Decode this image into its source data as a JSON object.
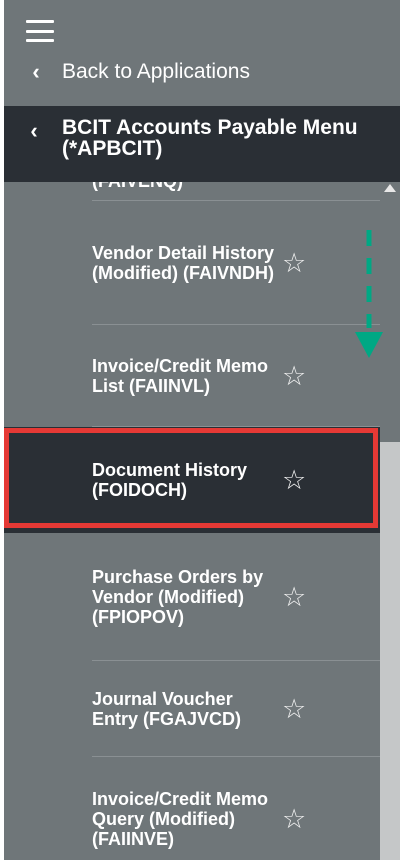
{
  "nav": {
    "back_label": "Back to Applications",
    "menu_title": "BCIT Accounts Payable Menu (*APBCIT)"
  },
  "menu_items": [
    {
      "label": "(FAIVENQ)"
    },
    {
      "label": "Vendor Detail History (Modified) (FAIVNDH)"
    },
    {
      "label": "Invoice/Credit Memo List (FAIINVL)"
    },
    {
      "label": "Document History (FOIDOCH)",
      "selected": true
    },
    {
      "label": "Purchase Orders by Vendor (Modified) (FPIOPOV)"
    },
    {
      "label": "Journal Voucher Entry (FGAJVCD)"
    },
    {
      "label": "Invoice/Credit Memo Query (Modified) (FAIINVE)"
    }
  ],
  "icons": {
    "menu": "hamburger-icon",
    "back": "chevron-left-icon",
    "favorite": "star-outline-icon"
  },
  "colors": {
    "panel": "#6f7679",
    "header": "#2a2f35",
    "selected": "#2a2f35",
    "highlight": "#e53935",
    "annotation_arrow": "#00a884"
  }
}
